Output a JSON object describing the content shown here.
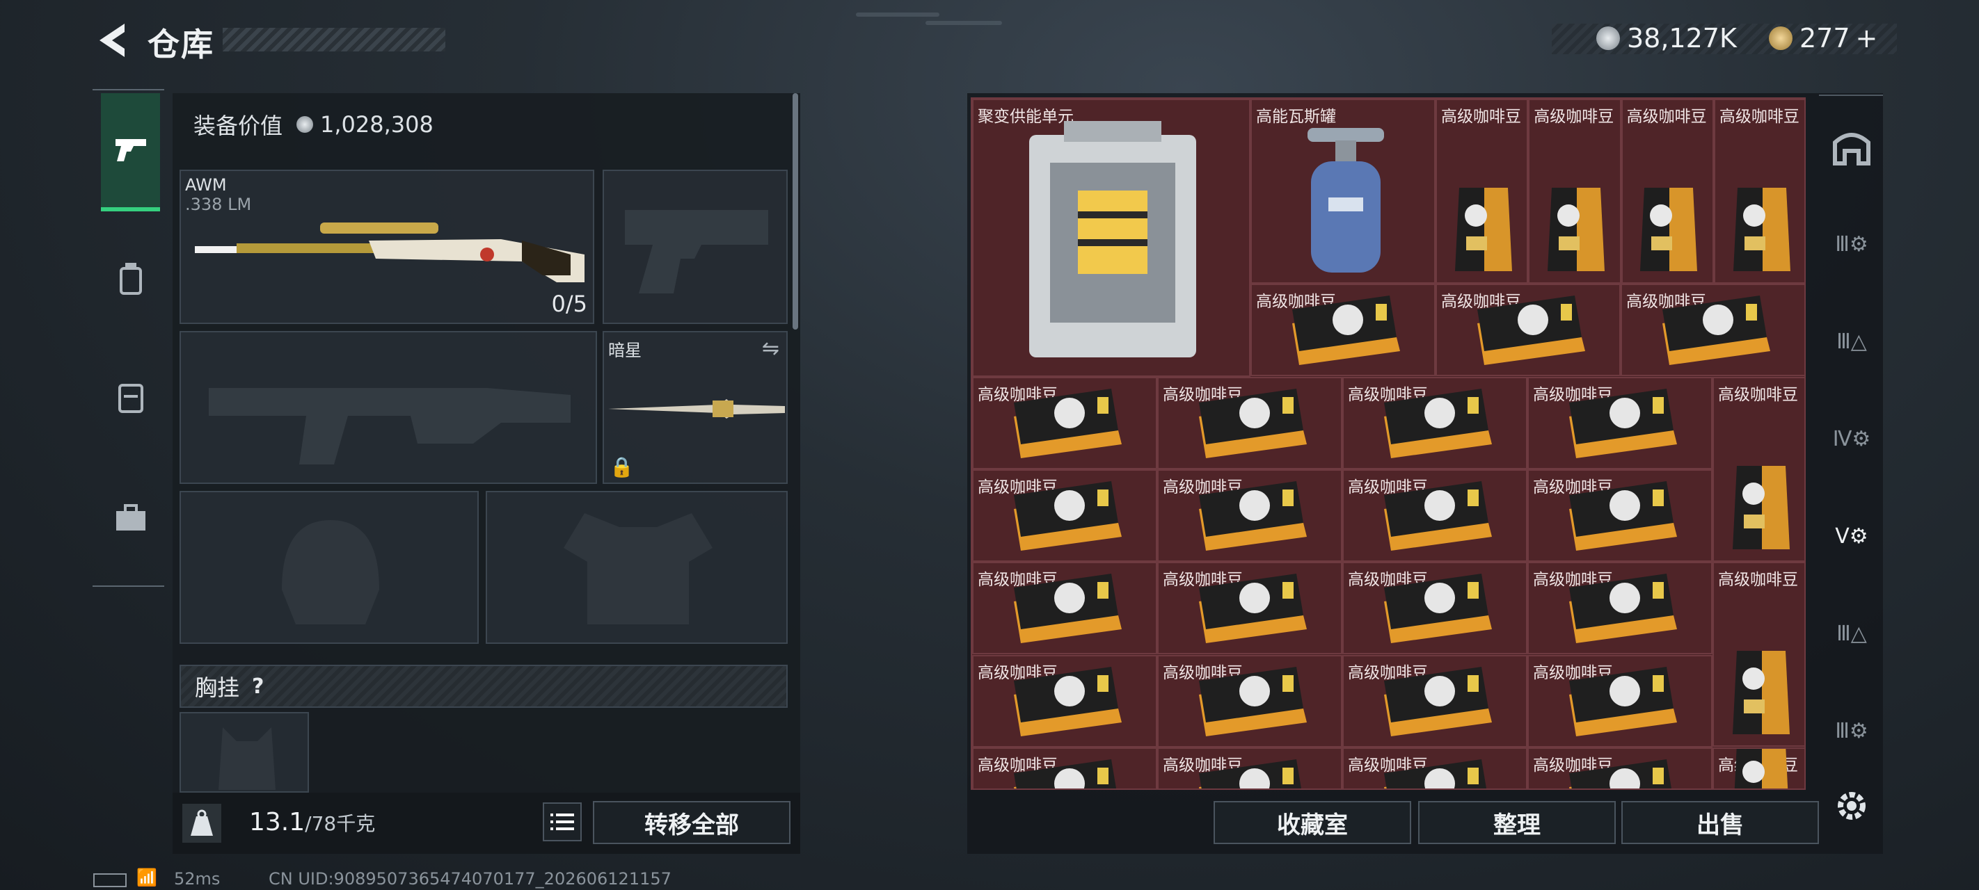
{
  "header": {
    "title": "仓库"
  },
  "currency": {
    "silver": "38,127K",
    "gold": "277",
    "gold_plus": "+"
  },
  "equipment": {
    "value_label": "装备价值",
    "value": "1,028,308",
    "primary": {
      "name": "AWM",
      "ammo": ".338 LM",
      "count": "0/5"
    },
    "melee": {
      "name": "暗星"
    },
    "chest_rig": {
      "label": "胸挂",
      "help": "?"
    }
  },
  "weight": {
    "current": "13.1",
    "max": "/78千克"
  },
  "actions": {
    "transfer_all": "转移全部",
    "collection": "收藏室",
    "organize": "整理",
    "sell": "出售"
  },
  "items": {
    "fusion": "聚变供能单元",
    "gas": "高能瓦斯罐",
    "coffee": "高级咖啡豆"
  },
  "footer": {
    "ping": "52ms",
    "uid": "CN UID:9089507365474070177_202606121157"
  },
  "colors": {
    "accent": "#35d07f",
    "grid_bg": "#4a2226"
  }
}
